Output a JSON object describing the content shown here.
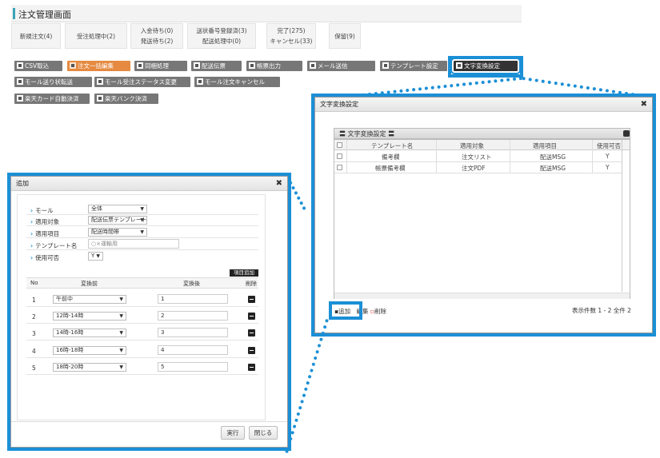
{
  "page": {
    "title": "注文管理画面"
  },
  "status_tabs": [
    {
      "line1": "新規注文(4)",
      "line2": ""
    },
    {
      "line1": "受注処理中(2)",
      "line2": ""
    },
    {
      "line1": "入金待ち(0)",
      "line2": "発送待ち(2)"
    },
    {
      "line1": "送状番号登録済(3)",
      "line2": "配送処理中(0)"
    },
    {
      "line1": "完了(275)",
      "line2": "キャンセル(33)"
    },
    {
      "line1": "保留(9)",
      "line2": ""
    }
  ],
  "toolbar": {
    "row1": [
      "CSV取込",
      "注文一括編集",
      "同梱処理",
      "配送伝票",
      "帳票出力",
      "メール送信",
      "テンプレート設定",
      "文字変換設定"
    ],
    "row2": [
      "モール送り状転送",
      "モール受注ステータス変更",
      "モール注文キャンセル"
    ],
    "row3": [
      "楽天カード自動決済",
      "楽天バンク決済"
    ]
  },
  "conv_dialog": {
    "title": "文字変換設定",
    "grid_title": "〓 文字変換設定 〓",
    "columns": [
      "テンプレート名",
      "適用対象",
      "適用項目",
      "使用可否"
    ],
    "rows": [
      {
        "name": "備考欄",
        "target": "注文リスト",
        "item": "配送MSG",
        "usable": "Y"
      },
      {
        "name": "帳票備考欄",
        "target": "注文PDF",
        "item": "配送MSG",
        "usable": "Y"
      }
    ],
    "add_label": "追加",
    "edit_label": "編集",
    "delete_label": "削除",
    "count_text": "表示件数 1 - 2 全件 2"
  },
  "add_dialog": {
    "title": "追加",
    "fields": [
      {
        "label": "モール",
        "value": "全体"
      },
      {
        "label": "適用対象",
        "value": "配送伝票テンプレート"
      },
      {
        "label": "適用項目",
        "value": "配送時間帯"
      },
      {
        "label": "テンプレート名",
        "value": "○×運輸用"
      },
      {
        "label": "使用可否",
        "value": "Y"
      }
    ],
    "add_item_label": "項目追加",
    "col_no": "No",
    "col_before": "変換前",
    "col_after": "変換後",
    "col_delete": "削除",
    "rows": [
      {
        "no": "1",
        "before": "午前中",
        "after": "1"
      },
      {
        "no": "2",
        "before": "12時-14時",
        "after": "2"
      },
      {
        "no": "3",
        "before": "14時-16時",
        "after": "3"
      },
      {
        "no": "4",
        "before": "16時-18時",
        "after": "4"
      },
      {
        "no": "5",
        "before": "18時-20時",
        "after": "5"
      }
    ],
    "execute_label": "実行",
    "close_label": "閉じる"
  }
}
